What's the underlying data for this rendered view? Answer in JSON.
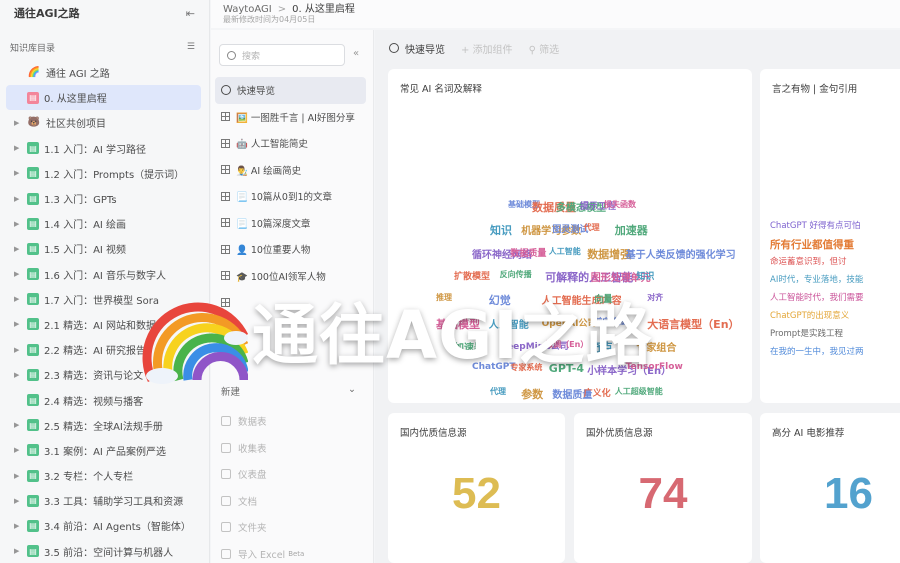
{
  "sidebar": {
    "title": "通往AGI之路",
    "section_label": "知识库目录",
    "items": [
      {
        "label": "通往 AGI 之路",
        "icon": "rainbow-icon",
        "caret": false
      },
      {
        "label": "0. 从这里启程",
        "icon": "page-icon",
        "caret": false,
        "selected": true
      },
      {
        "label": "社区共创项目",
        "icon": "bear-icon",
        "caret": true
      },
      {
        "label": "1.1 入门：AI 学习路径",
        "icon": "page-icon",
        "caret": true
      },
      {
        "label": "1.2 入门：Prompts（提示词）",
        "icon": "page-icon",
        "caret": true
      },
      {
        "label": "1.3 入门：GPTs",
        "icon": "page-icon",
        "caret": true
      },
      {
        "label": "1.4 入门：AI 绘画",
        "icon": "page-icon",
        "caret": true
      },
      {
        "label": "1.5 入门：AI 视频",
        "icon": "page-icon",
        "caret": true
      },
      {
        "label": "1.6 入门：AI 音乐与数字人",
        "icon": "page-icon",
        "caret": true
      },
      {
        "label": "1.7 入门：世界模型 Sora",
        "icon": "page-icon",
        "caret": true
      },
      {
        "label": "2.1 精选：AI 网站和数据",
        "icon": "page-icon",
        "caret": true
      },
      {
        "label": "2.2 精选：AI 研究报告",
        "icon": "page-icon",
        "caret": true
      },
      {
        "label": "2.3 精选：资讯与论文",
        "icon": "page-icon",
        "caret": true
      },
      {
        "label": "2.4 精选：视频与播客",
        "icon": "page-icon",
        "caret": false
      },
      {
        "label": "2.5 精选：全球AI法规手册",
        "icon": "page-icon",
        "caret": true
      },
      {
        "label": "3.1 案例：AI 产品案例严选",
        "icon": "page-icon",
        "caret": true
      },
      {
        "label": "3.2 专栏：个人专栏",
        "icon": "page-icon",
        "caret": true
      },
      {
        "label": "3.3 工具：辅助学习工具和资源",
        "icon": "page-icon",
        "caret": true
      },
      {
        "label": "3.4 前沿：AI Agents（智能体）",
        "icon": "page-icon",
        "caret": true
      },
      {
        "label": "3.5 前沿：空间计算与机器人",
        "icon": "page-icon",
        "caret": true
      }
    ]
  },
  "header": {
    "breadcrumb_root": "WaytoAGI",
    "breadcrumb_sep": ">",
    "breadcrumb_current": "0. 从这里启程",
    "modified": "最新修改时间为04月05日"
  },
  "midnav": {
    "search_placeholder": "搜索",
    "items": [
      {
        "label": "快速导览",
        "icon": "clock-icon",
        "selected": true
      },
      {
        "label": "🖼️ 一图胜千言 | AI好图分享",
        "icon": "table-icon"
      },
      {
        "label": "🤖 人工智能简史",
        "icon": "table-icon"
      },
      {
        "label": "👨‍🎨 AI 绘画简史",
        "icon": "table-icon"
      },
      {
        "label": "📃 10篇从0到1的文章",
        "icon": "table-icon"
      },
      {
        "label": "📃 10篇深度文章",
        "icon": "table-icon"
      },
      {
        "label": "👤 10位重要人物",
        "icon": "table-icon"
      },
      {
        "label": "🎓 100位AI领军人物",
        "icon": "table-icon"
      },
      {
        "label": "",
        "icon": "table-icon"
      },
      {
        "label": "",
        "icon": "table-icon"
      },
      {
        "label": "",
        "icon": "table-icon"
      }
    ],
    "new_label": "新建",
    "new_items": [
      "数据表",
      "收集表",
      "仪表盘",
      "文档",
      "文件夹",
      "导入 Excel"
    ],
    "beta": "Beta"
  },
  "dashboard": {
    "title": "快速导览",
    "add_widget": "添加组件",
    "filter": "筛选",
    "cards": {
      "wordcloud_title": "常见 AI 名词及解释",
      "quote_title": "言之有物 | 金句引用",
      "stat1_title": "国内优质信息源",
      "stat1_value": "52",
      "stat2_title": "国外优质信息源",
      "stat2_value": "74",
      "stat3_title": "高分 AI 电影推荐",
      "stat3_value": "16"
    },
    "colors": {
      "stat1": "#d9b33c",
      "stat2": "#d2555f",
      "stat3": "#3c96c8"
    }
  },
  "cloud_words": [
    "基础模型",
    "数据质量",
    "多模态模型",
    "提示工程",
    "损失函数",
    "知识",
    "机器学习参数",
    "图灵测试",
    "代理",
    "加速器",
    "循环神经网络",
    "数据质量",
    "人工智能",
    "数据增强",
    "基于人类反馈的强化学习",
    "扩散模型",
    "反向传播",
    "可解释的人工智能",
    "图形处理单元",
    "知识",
    "推理",
    "幻觉",
    "人工智能生成内容",
    "向量",
    "对齐",
    "基础模型",
    "人工智能",
    "OpenAI公司",
    "前向传播",
    "大语言模型（En）",
    "加速器",
    "DeepMind公司",
    "微调（En）",
    "奇点",
    "专家组合",
    "ChatGPT",
    "专家系统",
    "GPT-4",
    "小样本学习（En）",
    "TensorFlow",
    "代理",
    "参数",
    "数据质量",
    "广义化",
    "人工超级智能"
  ],
  "quote_lines": [
    "ChatGPT 好得有点可怕",
    "所有行业都值得重",
    "命运蓄意识到，但讨",
    "AI时代，专业落地，技能",
    "人工智能时代，我们需要",
    "ChatGPT的出现意义",
    "Prompt是实践工程",
    "在我的一生中，我见过两"
  ],
  "overlay": {
    "text": "通往AGI之路"
  }
}
